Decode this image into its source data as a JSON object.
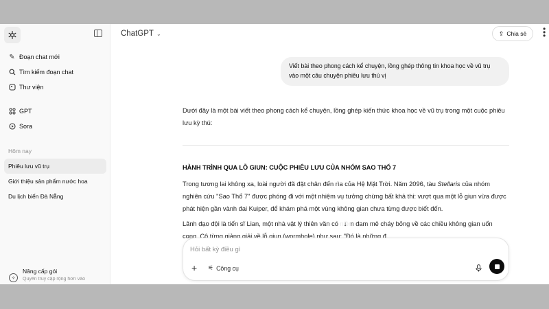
{
  "sidebar": {
    "items": [
      {
        "icon": "new-chat-icon",
        "label": "Đoạn chat mới"
      },
      {
        "icon": "search-icon",
        "label": "Tìm kiếm đoạn chat"
      },
      {
        "icon": "library-icon",
        "label": "Thư viện"
      },
      {
        "icon": "gpt-icon",
        "label": "GPT"
      },
      {
        "icon": "sora-icon",
        "label": "Sora"
      }
    ],
    "section_label": "Hôm nay",
    "chats": [
      {
        "label": "Phiêu lưu vũ trụ",
        "active": true
      },
      {
        "label": "Giới thiệu sản phẩm nước hoa"
      },
      {
        "label": "Du lịch biển Đà Nẵng"
      }
    ],
    "upgrade": {
      "title": "Nâng cấp gói",
      "subtitle": "Quyền truy cập rộng hơn vào"
    }
  },
  "header": {
    "model": "ChatGPT",
    "share_label": "Chia sẻ"
  },
  "conversation": {
    "user_message": "Viết bài theo phong cách kể chuyện, lồng ghép thông tin khoa học về vũ trụ vào một câu chuyện phiêu lưu thú vị",
    "intro": "Dưới đây là một bài viết theo phong cách kể chuyện, lồng ghép kiến thức khoa học về vũ trụ trong một cuộc phiêu lưu kỳ thú:",
    "heading": "HÀNH TRÌNH QUA LỖ GIUN: CUỘC PHIÊU LƯU CỦA NHÓM SAO THỔ 7",
    "p1_before": "Trong tương lai không xa, loài người đã đặt chân đến rìa của Hệ Mặt Trời. Năm 2096, tàu ",
    "p1_italic": "Stellaris",
    "p1_after": " của nhóm nghiên cứu \"Sao Thổ 7\" được phóng đi với một nhiệm vụ tưởng chừng bất khả thi: vượt qua một lỗ giun vừa được phát hiện gần vành đai Kuiper, để khám phá một vùng không gian chưa từng được biết đến.",
    "p2": "Lãnh đạo đội là tiến sĩ Lian, một nhà vật lý thiên văn có niềm đam mê cháy bỏng về các chiều không gian uốn cong. Cô từng giảng giải về lỗ giun (wormhole) như sau: \"Đó là những đ"
  },
  "composer": {
    "placeholder": "Hỏi bất kỳ điều gì",
    "tools_label": "Công cụ"
  }
}
